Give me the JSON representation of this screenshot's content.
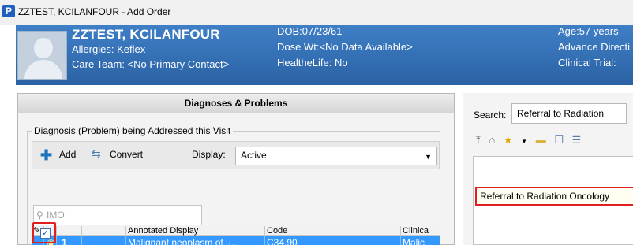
{
  "window": {
    "title": "ZZTEST, KCILANFOUR - Add Order",
    "app_icon_letter": "P"
  },
  "banner": {
    "patient_name": "ZZTEST, KCILANFOUR",
    "allergies": "Allergies: Keflex",
    "care_team": "Care Team: <No Primary Contact>",
    "dob": "DOB:07/23/61",
    "dose_wt": "Dose Wt:<No Data Available>",
    "healthelife": "HealtheLife: No",
    "age": "Age:57 years",
    "advance_directive": "Advance Directi",
    "clinical_trial": "Clinical Trial:"
  },
  "left_panel": {
    "header": "Diagnoses & Problems",
    "group_label": "Diagnosis (Problem) being Addressed this Visit",
    "toolbar": {
      "add_label": "Add",
      "convert_label": "Convert",
      "display_label": "Display:",
      "display_value": "Active"
    },
    "imo_placeholder": "IMO",
    "grid": {
      "columns": [
        "Annotated Display",
        "Code",
        "Clinica"
      ],
      "row": {
        "number": "1",
        "display": "Malignant neoplasm of u...",
        "code": "C34.90",
        "clinical": "Malic"
      }
    }
  },
  "right_panel": {
    "search_label": "Search:",
    "search_value": "Referral to Radiation",
    "result_item": "Referral to Radiation Oncology"
  },
  "colors": {
    "banner": "#2b62a4",
    "selection": "#3399ff",
    "highlight_border": "#e02020"
  }
}
